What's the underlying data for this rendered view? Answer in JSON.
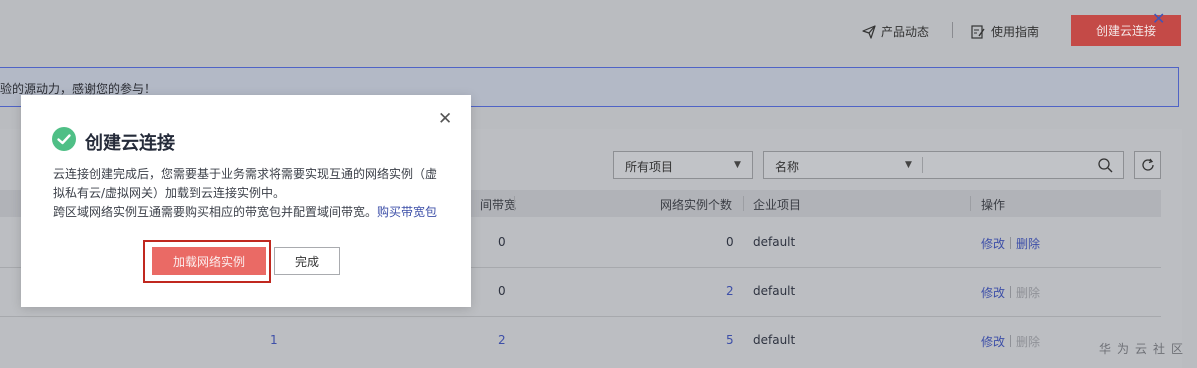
{
  "header": {
    "product_news": "产品动态",
    "user_guide": "使用指南",
    "create_button": "创建云连接"
  },
  "notice": {
    "text": "验的源动力，感谢您的参与！"
  },
  "filters": {
    "project_select": "所有项目",
    "name_select": "名称"
  },
  "table": {
    "headers": {
      "bandwidth": "间带宽",
      "instance_count": "网络实例个数",
      "enterprise_project": "企业项目",
      "actions": "操作"
    },
    "rows": [
      {
        "col_a": "",
        "bandwidth": "0",
        "instance_count": "0",
        "enterprise_project": "default",
        "modify": "修改",
        "delete": "删除"
      },
      {
        "col_a": "",
        "bandwidth": "0",
        "instance_count": "2",
        "enterprise_project": "default",
        "modify": "修改",
        "delete": "删除"
      },
      {
        "col_a": "1",
        "bandwidth": "2",
        "instance_count": "5",
        "enterprise_project": "default",
        "modify": "修改",
        "delete": "删除"
      }
    ]
  },
  "modal": {
    "title": "创建云连接",
    "body_line1": "云连接创建完成后，您需要基于业务需求将需要实现互通的网络实例（虚",
    "body_line2": "拟私有云/虚拟网关）加载到云连接实例中。",
    "body_line3": "跨区域网络实例互通需要购买相应的带宽包并配置域间带宽。",
    "buy_link": "购买带宽包",
    "load_button": "加载网络实例",
    "done_button": "完成"
  },
  "watermark": "华为云社区",
  "colors": {
    "primary_red": "#c44a47",
    "load_button": "#ea6a65",
    "success_green": "#4fbf86",
    "link_blue": "#3d4fa8"
  }
}
